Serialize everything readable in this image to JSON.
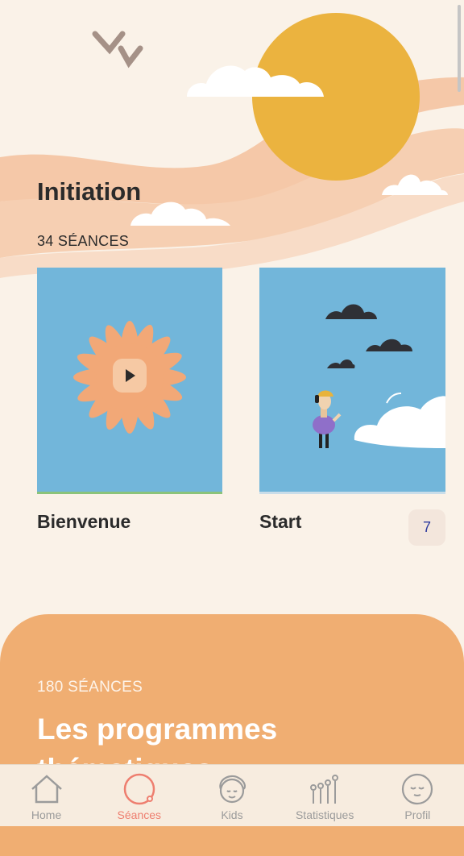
{
  "section": {
    "title": "Initiation",
    "count": "34 SÉANCES"
  },
  "cards": [
    {
      "title": "Bienvenue"
    },
    {
      "title": "Start",
      "badge": "7"
    }
  ],
  "programs": {
    "count": "180 SÉANCES",
    "title": "Les programmes thématiques"
  },
  "tabbar": {
    "items": [
      {
        "label": "Home",
        "icon": "house-icon"
      },
      {
        "label": "Séances",
        "icon": "circle-icon",
        "active": true
      },
      {
        "label": "Kids",
        "icon": "child-face-icon"
      },
      {
        "label": "Statistiques",
        "icon": "stats-icon"
      },
      {
        "label": "Profil",
        "icon": "profile-face-icon"
      }
    ]
  },
  "colors": {
    "accent": "#ee7e6f",
    "sun": "#ebb33f",
    "card_bg": "#72b6da",
    "panel": "#f0ae72"
  }
}
